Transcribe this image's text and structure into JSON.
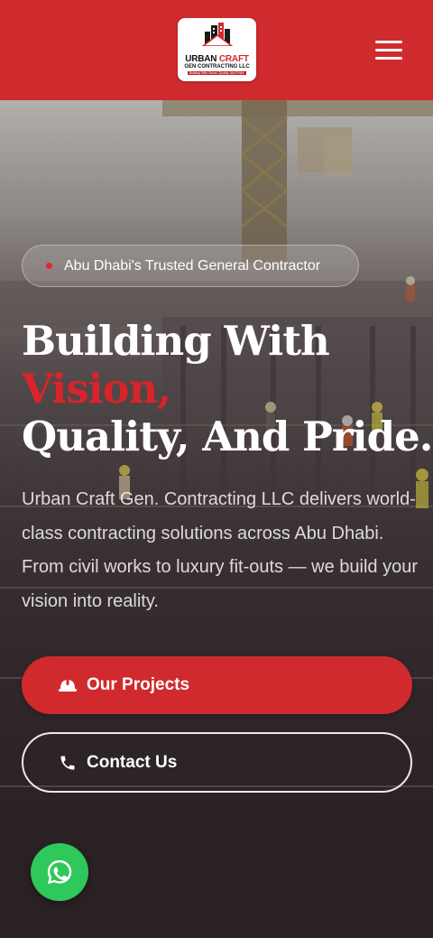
{
  "header": {
    "logo": {
      "name_part1": "URBAN ",
      "name_part2": "CRAFT",
      "subtitle": "GEN CONTRACTING LLC",
      "tagline": "Building With Vision, Quality, And Pride."
    },
    "menu_icon": "hamburger-menu-icon"
  },
  "hero": {
    "badge_text": "Abu Dhabi's Trusted General Contractor",
    "headline": {
      "line1": "Building With",
      "line2_accent": "Vision,",
      "line3": "Quality, And Pride."
    },
    "description": "Urban Craft Gen. Contracting LLC delivers world-class contracting solutions across Abu Dhabi. From civil works to luxury fit-outs — we build your vision into reality.",
    "primary_button": {
      "label": "Our Projects",
      "icon": "hard-hat-icon"
    },
    "secondary_button": {
      "label": "Contact Us",
      "icon": "phone-icon"
    }
  },
  "floating": {
    "whatsapp_icon": "whatsapp-icon"
  },
  "colors": {
    "brand_red": "#d12a2e",
    "accent_red": "#d8242a",
    "whatsapp_green": "#2fc85a",
    "text_white": "#ffffff"
  }
}
